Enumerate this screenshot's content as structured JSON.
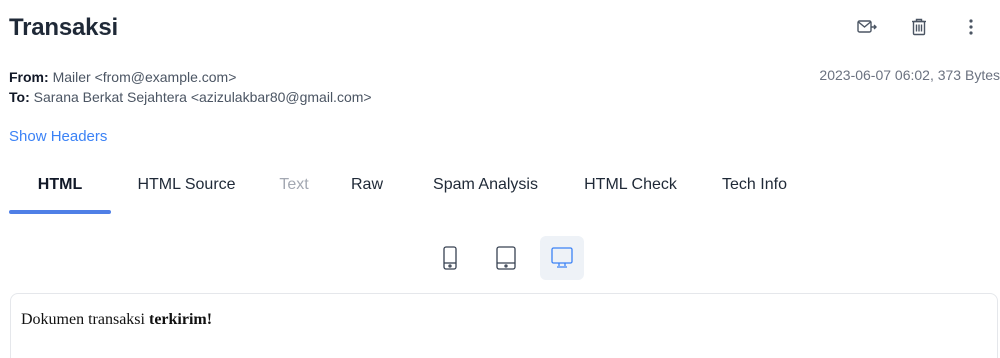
{
  "header": {
    "title": "Transaksi",
    "actions": [
      {
        "name": "forward-icon"
      },
      {
        "name": "trash-icon"
      },
      {
        "name": "more-vertical-icon"
      }
    ]
  },
  "meta": {
    "from_label": "From:",
    "from_value": "Mailer <from@example.com>",
    "to_label": "To:",
    "to_value": "Sarana Berkat Sejahtera <azizulakbar80@gmail.com>",
    "date_size": "2023-06-07 06:02, 373 Bytes"
  },
  "show_headers": "Show Headers",
  "tabs": [
    {
      "label": "HTML",
      "state": "active"
    },
    {
      "label": "HTML Source",
      "state": "normal"
    },
    {
      "label": "Text",
      "state": "disabled"
    },
    {
      "label": "Raw",
      "state": "normal"
    },
    {
      "label": "Spam Analysis",
      "state": "normal"
    },
    {
      "label": "HTML Check",
      "state": "normal"
    },
    {
      "label": "Tech Info",
      "state": "normal"
    }
  ],
  "devices": [
    {
      "name": "mobile-icon",
      "active": false
    },
    {
      "name": "tablet-icon",
      "active": false
    },
    {
      "name": "desktop-icon",
      "active": true
    }
  ],
  "preview": {
    "text_normal": "Dokumen transaksi ",
    "text_bold": "terkirim!"
  },
  "colors": {
    "accent": "#4f7fe6",
    "link": "#3b82f6",
    "title": "#1f2937"
  }
}
